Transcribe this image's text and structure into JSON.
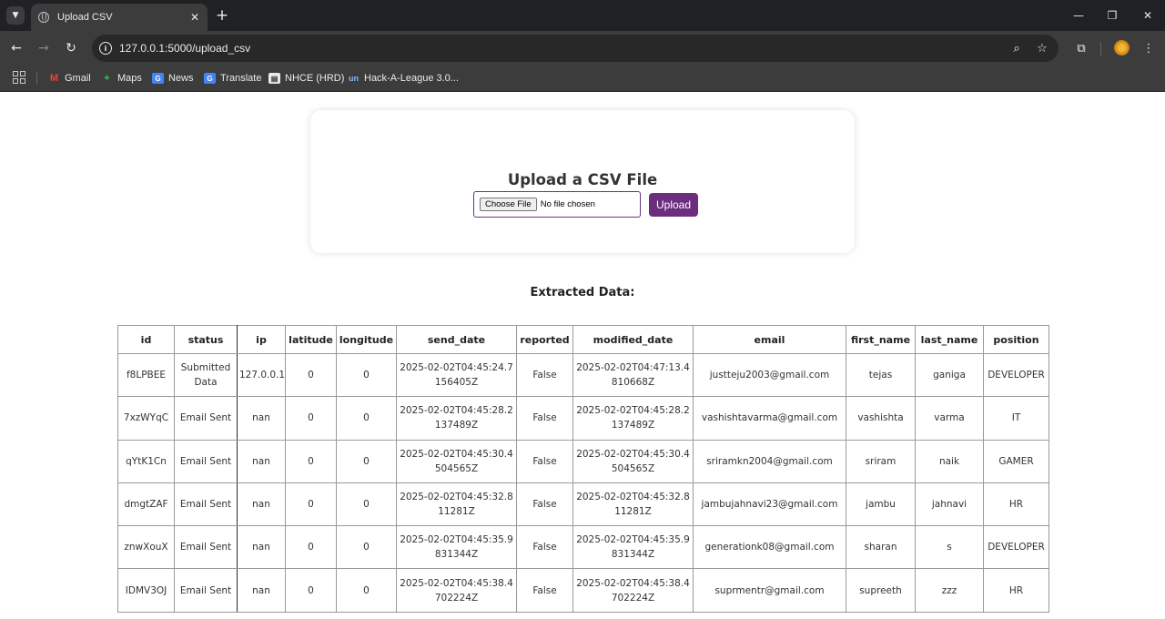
{
  "browser": {
    "tab_title": "Upload CSV",
    "url": "127.0.0.1:5000/upload_csv",
    "bookmarks": [
      {
        "label": "Gmail"
      },
      {
        "label": "Maps"
      },
      {
        "label": "News"
      },
      {
        "label": "Translate"
      },
      {
        "label": "NHCE (HRD)"
      },
      {
        "label": "Hack-A-League 3.0..."
      }
    ]
  },
  "upload": {
    "title": "Upload a CSV File",
    "choose_label": "Choose File",
    "no_file_text": "No file chosen",
    "upload_label": "Upload"
  },
  "extracted_title": "Extracted Data:",
  "table": {
    "headers": [
      "id",
      "status",
      "ip",
      "latitude",
      "longitude",
      "send_date",
      "reported",
      "modified_date",
      "email",
      "first_name",
      "last_name",
      "position"
    ],
    "rows": [
      {
        "id": "f8LPBEE",
        "status": "Submitted Data",
        "ip": "127.0.0.1",
        "latitude": "0",
        "longitude": "0",
        "send_date": "2025-02-02T04:45:24.7156405Z",
        "reported": "False",
        "modified_date": "2025-02-02T04:47:13.4810668Z",
        "email": "justteju2003@gmail.com",
        "first_name": "tejas",
        "last_name": "ganiga",
        "position": "DEVELOPER"
      },
      {
        "id": "7xzWYqC",
        "status": "Email Sent",
        "ip": "nan",
        "latitude": "0",
        "longitude": "0",
        "send_date": "2025-02-02T04:45:28.2137489Z",
        "reported": "False",
        "modified_date": "2025-02-02T04:45:28.2137489Z",
        "email": "vashishtavarma@gmail.com",
        "first_name": "vashishta",
        "last_name": "varma",
        "position": "IT"
      },
      {
        "id": "qYtK1Cn",
        "status": "Email Sent",
        "ip": "nan",
        "latitude": "0",
        "longitude": "0",
        "send_date": "2025-02-02T04:45:30.4504565Z",
        "reported": "False",
        "modified_date": "2025-02-02T04:45:30.4504565Z",
        "email": "sriramkn2004@gmail.com",
        "first_name": "sriram",
        "last_name": "naik",
        "position": "GAMER"
      },
      {
        "id": "dmgtZAF",
        "status": "Email Sent",
        "ip": "nan",
        "latitude": "0",
        "longitude": "0",
        "send_date": "2025-02-02T04:45:32.811281Z",
        "reported": "False",
        "modified_date": "2025-02-02T04:45:32.811281Z",
        "email": "jambujahnavi23@gmail.com",
        "first_name": "jambu",
        "last_name": "jahnavi",
        "position": "HR"
      },
      {
        "id": "znwXouX",
        "status": "Email Sent",
        "ip": "nan",
        "latitude": "0",
        "longitude": "0",
        "send_date": "2025-02-02T04:45:35.9831344Z",
        "reported": "False",
        "modified_date": "2025-02-02T04:45:35.9831344Z",
        "email": "generationk08@gmail.com",
        "first_name": "sharan",
        "last_name": "s",
        "position": "DEVELOPER"
      },
      {
        "id": "IDMV3OJ",
        "status": "Email Sent",
        "ip": "nan",
        "latitude": "0",
        "longitude": "0",
        "send_date": "2025-02-02T04:45:38.4702224Z",
        "reported": "False",
        "modified_date": "2025-02-02T04:45:38.4702224Z",
        "email": "suprmentr@gmail.com",
        "first_name": "supreeth",
        "last_name": "zzz",
        "position": "HR"
      }
    ]
  }
}
